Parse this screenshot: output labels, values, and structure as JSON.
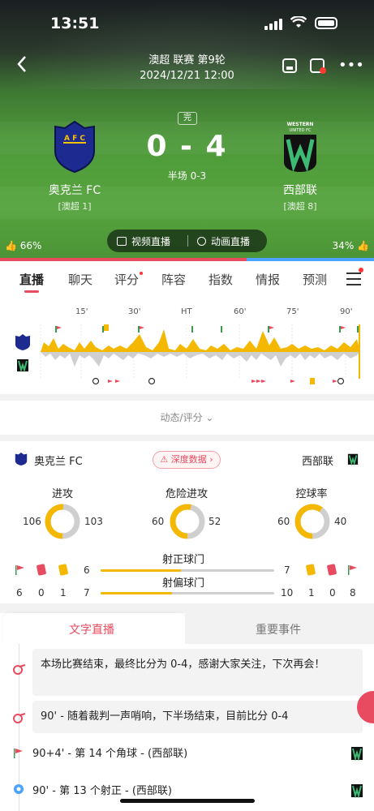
{
  "status_bar": {
    "time": "13:51"
  },
  "header": {
    "league": "澳超 联赛 第9轮",
    "date": "2024/12/21 12:00"
  },
  "match": {
    "status": "完",
    "score": "0 - 4",
    "half_time": "半场 0-3",
    "home": {
      "name": "奥克兰 FC",
      "rank": "[澳超 1]",
      "logo_text": "AFC"
    },
    "away": {
      "name": "西部联",
      "rank": "[澳超 8]",
      "logo_text": "WESTERN UNITED FC"
    },
    "support_home": "66%",
    "support_away": "34%"
  },
  "live_buttons": {
    "video": "视频直播",
    "animation": "动画直播"
  },
  "tabs": [
    "直播",
    "聊天",
    "评分",
    "阵容",
    "指数",
    "情报",
    "预测"
  ],
  "timeline": {
    "ticks": [
      "15'",
      "30'",
      "HT",
      "60'",
      "75'",
      "90'"
    ]
  },
  "dynamics_label": "动态/评分",
  "stats": {
    "home_team": "奥克兰 FC",
    "away_team": "西部联",
    "deep_data": "深度数据",
    "attack": {
      "label": "进攻",
      "home": "106",
      "away": "103",
      "home_share": 0.507
    },
    "danger": {
      "label": "危险进攻",
      "home": "60",
      "away": "52",
      "home_share": 0.536
    },
    "possession": {
      "label": "控球率",
      "home": "60",
      "away": "40",
      "home_share": 0.6
    },
    "corners_home": "6",
    "red_home": "0",
    "yellow_home": "1",
    "corners_away": "8",
    "red_away": "0",
    "yellow_away": "1",
    "on_target": {
      "label": "射正球门",
      "home": "6",
      "away": "7"
    },
    "off_target": {
      "label": "射偏球门",
      "home": "7",
      "away": "10"
    }
  },
  "subtabs": {
    "text_live": "文字直播",
    "key_events": "重要事件"
  },
  "feed": [
    {
      "text": "本场比赛结束，最终比分为 0-4，感谢大家关注，下次再会！"
    },
    {
      "text": "90' - 随着裁判一声哨响，下半场结束，目前比分 0-4"
    },
    {
      "text": "90+4' - 第 14 个角球 - (西部联)"
    },
    {
      "text": "90' - 第 13 个射正 - (西部联)"
    }
  ],
  "colors": {
    "accent": "#e84a5f",
    "home_bar": "#f5b800",
    "away_bar": "#cfcfcf"
  }
}
